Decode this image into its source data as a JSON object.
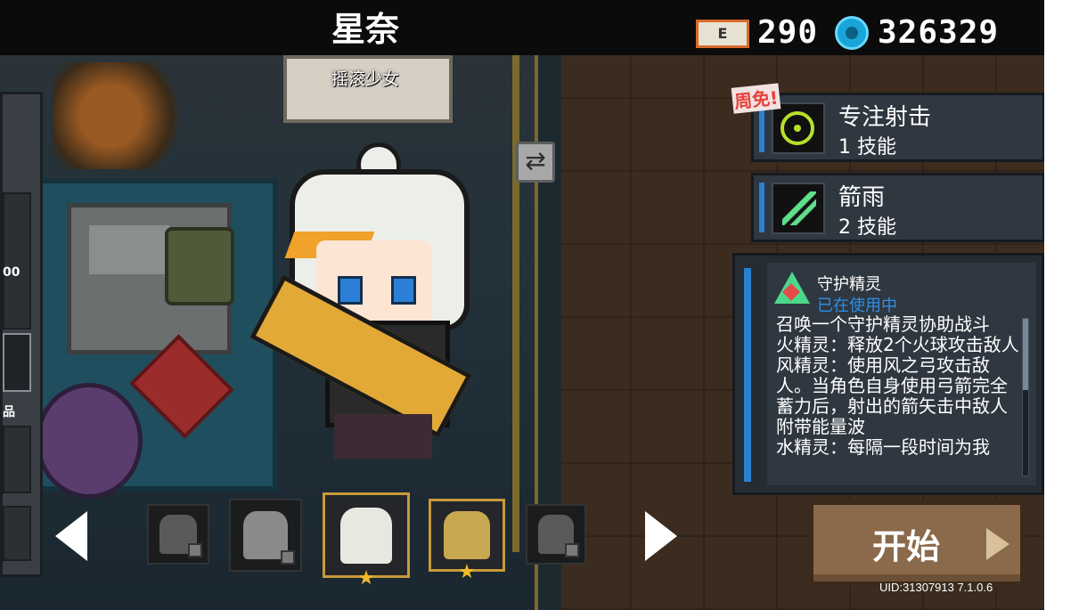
{
  "hero": {
    "name": "星奈",
    "subtitle": "摇滚少女"
  },
  "currency": {
    "gem_count": "290",
    "gem_icon_label": "E",
    "coin_count": "326329"
  },
  "skills": [
    {
      "title": "专注射击",
      "sub": "1 技能",
      "badge": "周免!",
      "icon": "crosshair-icon"
    },
    {
      "title": "箭雨",
      "sub": "2 技能",
      "icon": "arrow-rain-icon"
    }
  ],
  "pet": {
    "name": "守护精灵",
    "status": "已在使用中",
    "desc": [
      "召唤一个守护精灵协助战斗",
      "火精灵：释放2个火球攻击敌人",
      "风精灵：使用风之弓攻击敌人。当角色自身使用弓箭完全蓄力后，射出的箭矢击中敌人附带能量波",
      "水精灵：每隔一段时间为我"
    ]
  },
  "left_panel": {
    "text1": "00",
    "text2": "品"
  },
  "start": {
    "label": "开始"
  },
  "uid": "UID:31307913 7.1.0.6",
  "colors": {
    "accent_blue": "#2a7fd1",
    "status_blue": "#2f8fe6",
    "star_gold": "#f2b92b",
    "badge_red": "#e8403a"
  }
}
